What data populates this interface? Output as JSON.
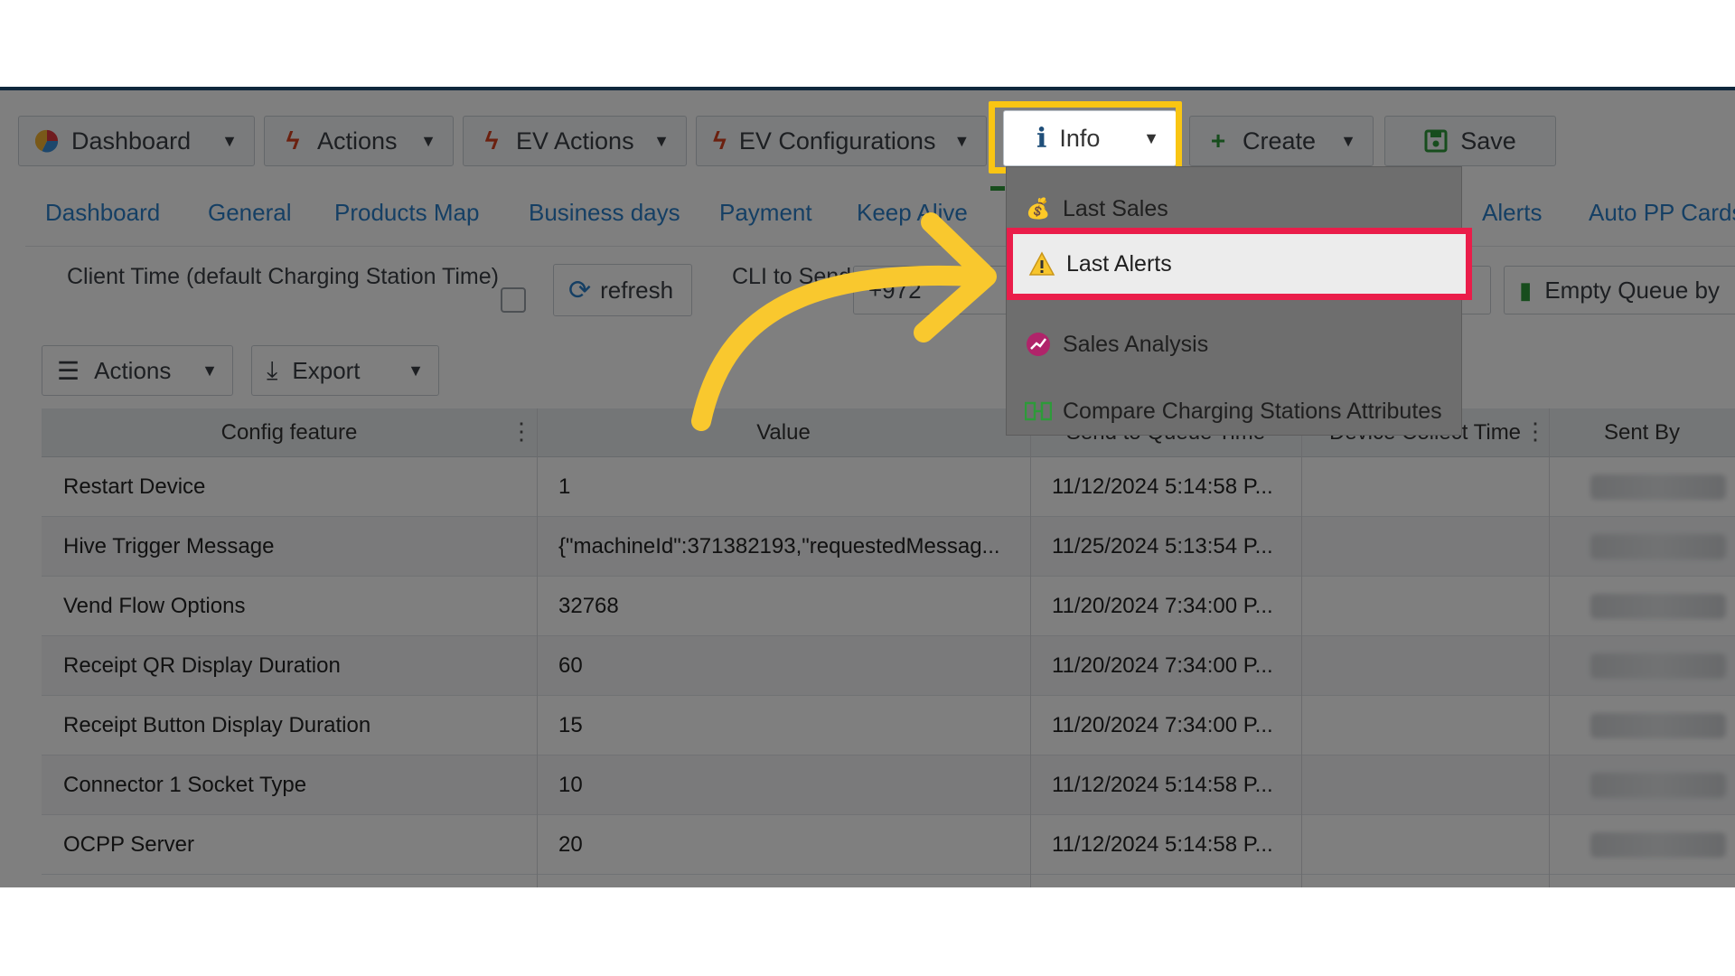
{
  "toolbar": {
    "dashboard": "Dashboard",
    "actions": "Actions",
    "ev_actions": "EV Actions",
    "ev_configurations": "EV Configurations",
    "info": "Info",
    "create": "Create",
    "save": "Save"
  },
  "tabs": [
    "Dashboard",
    "General",
    "Products Map",
    "Business days",
    "Payment",
    "Keep Alive",
    "Alerts",
    "Auto PP Cards"
  ],
  "controls": {
    "client_time_label": "Client Time (default Charging Station Time)",
    "refresh_label": "refresh",
    "cli_label": "CLI to Send",
    "cli_value": "+972",
    "empty_queue_label": "Empty Queue by"
  },
  "grid_toolbar": {
    "actions": "Actions",
    "export": "Export"
  },
  "grid": {
    "headers": [
      "Config feature",
      "Value",
      "Send to Queue Time",
      "Device Collect Time",
      "Sent By"
    ],
    "rows": [
      {
        "feature": "Restart Device",
        "value": "1",
        "time": "11/12/2024 5:14:58 P..."
      },
      {
        "feature": "Hive Trigger Message",
        "value": "{\"machineId\":371382193,\"requestedMessag...",
        "time": "11/25/2024 5:13:54 P..."
      },
      {
        "feature": "Vend Flow Options",
        "value": "32768",
        "time": "11/20/2024 7:34:00 P..."
      },
      {
        "feature": "Receipt QR Display Duration",
        "value": "60",
        "time": "11/20/2024 7:34:00 P..."
      },
      {
        "feature": "Receipt Button Display Duration",
        "value": "15",
        "time": "11/20/2024 7:34:00 P..."
      },
      {
        "feature": "Connector 1 Socket Type",
        "value": "10",
        "time": "11/12/2024 5:14:58 P..."
      },
      {
        "feature": "OCPP Server",
        "value": "20",
        "time": "11/12/2024 5:14:58 P..."
      }
    ]
  },
  "info_menu": {
    "items": [
      "Last Sales",
      "Last Alerts",
      "Sales Analysis",
      "Compare Charging Stations Attributes"
    ]
  },
  "colors": {
    "highlight_button": "#f9c513",
    "highlight_menu_item": "#ea1d4a",
    "arrow": "#f9c82e",
    "tab_link": "#2a7fc9"
  }
}
